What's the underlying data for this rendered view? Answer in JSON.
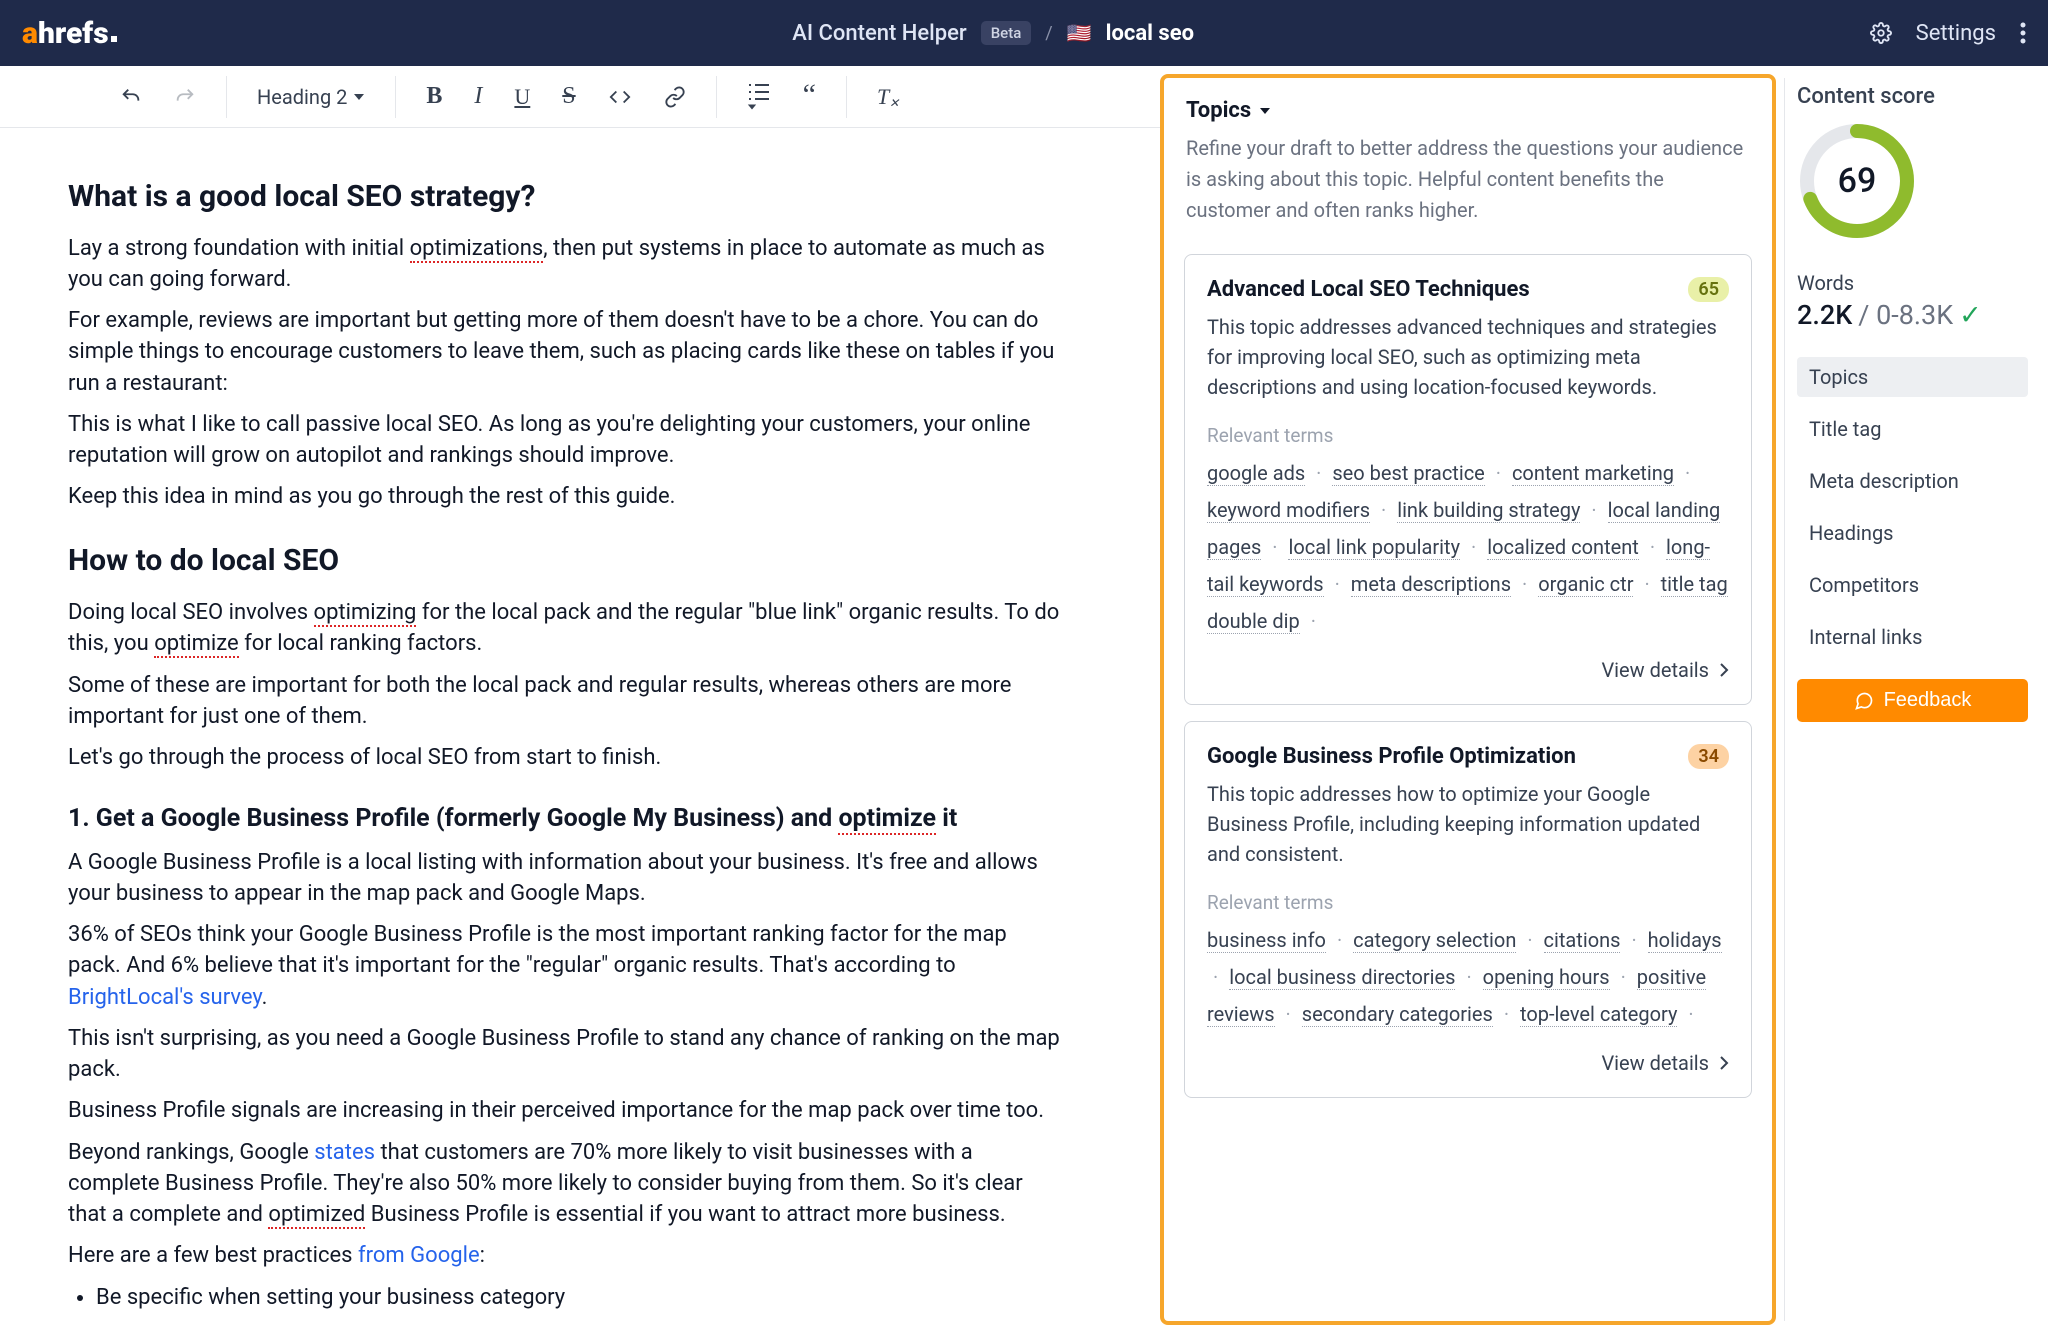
{
  "nav": {
    "appName": "AI Content Helper",
    "beta": "Beta",
    "sep": "/",
    "keyword": "local seo",
    "settings": "Settings"
  },
  "toolbar": {
    "headingLabel": "Heading 2"
  },
  "doc": {
    "h2a": "What is a good local SEO strategy?",
    "p1a": "Lay a strong foundation with initial ",
    "p1b": "optimizations",
    "p1c": ", then put systems in place to automate as much as you can going forward.",
    "p2": "For example, reviews are important but getting more of them doesn't have to be a chore. You can do simple things to encourage customers to leave them, such as placing cards like these on tables if you run a restaurant:",
    "p3": "This is what I like to call passive local SEO. As long as you're delighting your customers, your online reputation will grow on autopilot and rankings should improve.",
    "p4": "Keep this idea in mind as you go through the rest of this guide.",
    "h2b": "How to do local SEO",
    "p5a": "Doing local SEO involves ",
    "p5b": "optimizing",
    "p5c": " for the local pack and the regular \"blue link\" organic results. To do this, you ",
    "p5d": "optimize",
    "p5e": " for local ranking factors.",
    "p6": "Some of these are important for both the local pack and regular results, whereas others are more important for just one of them.",
    "p7": "Let's go through the process of local SEO from start to finish.",
    "h3a_a": "1. Get a Google Business Profile (formerly Google My Business) and ",
    "h3a_b": "optimize",
    "h3a_c": " it",
    "p8": "A Google Business Profile is a local listing with information about your business. It's free and allows your business to appear in the map pack and Google Maps.",
    "p9a": "36% of SEOs think your Google Business Profile is the most important ranking factor for the map pack. And 6% believe that it's important for the \"regular\" organic results. That's according to ",
    "p9b": "BrightLocal's survey",
    "p9c": ".",
    "p10": "This isn't surprising, as you need a Google Business Profile to stand any chance of ranking on the map pack.",
    "p11": "Business Profile signals are increasing in their perceived importance for the map pack over time too.",
    "p12a": "Beyond rankings, Google ",
    "p12b": "states",
    "p12c": " that customers are 70% more likely to visit businesses with a complete Business Profile. They're also 50% more likely to consider buying from them. So it's clear that a complete and ",
    "p12d": "optimized",
    "p12e": " Business Profile is essential if you want to attract more business.",
    "p13a": "Here are a few best practices ",
    "p13b": "from Google",
    "p13c": ":",
    "li1": "Be specific when setting your business category"
  },
  "topics": {
    "title": "Topics",
    "sub": "Refine your draft to better address the questions your audience is asking about this topic. Helpful content benefits the customer and often ranks higher.",
    "viewDetails": "View details",
    "relevantLabel": "Relevant terms",
    "cards": [
      {
        "title": "Advanced Local SEO Techniques",
        "badge": "65",
        "desc": "This topic addresses advanced techniques and strategies for improving local SEO, such as optimizing meta descriptions and using location-focused keywords.",
        "terms": [
          "google ads",
          "seo best practice",
          "content marketing",
          "keyword modifiers",
          "link building strategy",
          "local landing pages",
          "local link popularity",
          "localized content",
          "long-tail keywords",
          "meta descriptions",
          "organic ctr",
          "title tag double dip"
        ]
      },
      {
        "title": "Google Business Profile Optimization",
        "badge": "34",
        "desc": "This topic addresses how to optimize your Google Business Profile, including keeping information updated and consistent.",
        "terms": [
          "business info",
          "category selection",
          "citations",
          "holidays",
          "local business directories",
          "opening hours",
          "positive reviews",
          "secondary categories",
          "top-level category"
        ]
      }
    ]
  },
  "score": {
    "title": "Content score",
    "value": "69",
    "wordsLabel": "Words",
    "wordsValue": "2.2K",
    "wordsRangeSep": "/",
    "wordsRange": "0-8.3K",
    "tabs": [
      "Topics",
      "Title tag",
      "Meta description",
      "Headings",
      "Competitors",
      "Internal links"
    ],
    "feedback": "Feedback"
  }
}
